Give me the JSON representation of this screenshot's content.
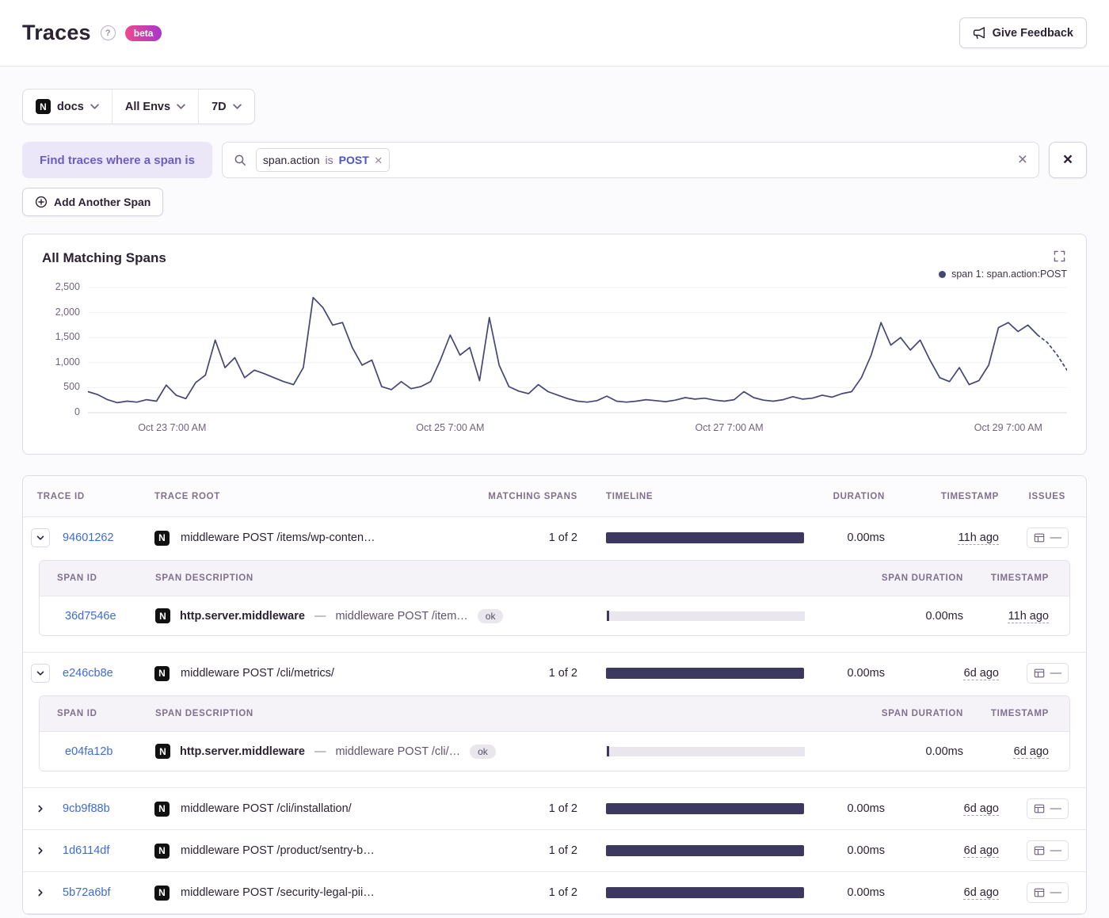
{
  "header": {
    "title": "Traces",
    "beta_label": "beta",
    "feedback_label": "Give Feedback"
  },
  "brand": {
    "project_icon_letter": "N"
  },
  "filters": {
    "project_label": "docs",
    "env_label": "All Envs",
    "period_label": "7D"
  },
  "span_filter": {
    "pill_label": "Find traces where a span is",
    "token_key": "span.action",
    "token_op": "is",
    "token_value": "POST",
    "add_label": "Add Another Span"
  },
  "chart_card": {
    "title": "All Matching Spans",
    "legend_label": "span 1: span.action:POST"
  },
  "chart_data": {
    "type": "line",
    "title": "All Matching Spans",
    "series": [
      {
        "name": "span 1: span.action:POST",
        "values": [
          420,
          360,
          260,
          200,
          230,
          210,
          260,
          230,
          550,
          350,
          280,
          600,
          750,
          1450,
          900,
          1100,
          700,
          850,
          780,
          700,
          620,
          560,
          900,
          2300,
          2100,
          1750,
          1800,
          1300,
          950,
          1050,
          520,
          460,
          620,
          480,
          520,
          620,
          1050,
          1550,
          1150,
          1300,
          640,
          1900,
          950,
          520,
          430,
          380,
          560,
          420,
          350,
          280,
          230,
          210,
          240,
          330,
          230,
          210,
          230,
          260,
          240,
          220,
          250,
          300,
          270,
          290,
          250,
          230,
          260,
          420,
          300,
          250,
          230,
          260,
          320,
          270,
          290,
          350,
          310,
          380,
          420,
          700,
          1150,
          1800,
          1350,
          1500,
          1250,
          1450,
          1050,
          700,
          620,
          900,
          560,
          640,
          950,
          1700,
          1800,
          1620,
          1750,
          1550,
          1400,
          1150,
          850
        ]
      }
    ],
    "ylim": [
      0,
      2500
    ],
    "y_tick_values": [
      0,
      500,
      1000,
      1500,
      2000,
      2500
    ],
    "y_ticks": [
      "0",
      "500",
      "1,000",
      "1,500",
      "2,000",
      "2,500"
    ],
    "x_tick_labels": [
      "Oct 23 7:00 AM",
      "Oct 25 7:00 AM",
      "Oct 27 7:00 AM",
      "Oct 29 7:00 AM"
    ],
    "x_tick_positions": [
      0.086,
      0.37,
      0.655,
      0.94
    ],
    "grid": "horizontal",
    "legend_position": "top-right",
    "dashed_tail_points": 4
  },
  "table": {
    "headers": {
      "trace_id": "TRACE ID",
      "trace_root": "TRACE ROOT",
      "matching": "MATCHING SPANS",
      "timeline": "TIMELINE",
      "duration": "DURATION",
      "timestamp": "TIMESTAMP",
      "issues": "ISSUES"
    },
    "span_headers": {
      "span_id": "SPAN ID",
      "span_description": "SPAN DESCRIPTION",
      "span_duration": "SPAN DURATION",
      "timestamp": "TIMESTAMP"
    },
    "rows": [
      {
        "trace_id": "94601262",
        "root": "middleware POST /items/wp-conten…",
        "matching": "1 of 2",
        "duration": "0.00ms",
        "timestamp": "11h ago",
        "issues": "—",
        "expanded": true,
        "spans": [
          {
            "span_id": "36d7546e",
            "op": "http.server.middleware",
            "separator": "—",
            "description": "middleware POST /item…",
            "status": "ok",
            "duration": "0.00ms",
            "timestamp": "11h ago"
          }
        ]
      },
      {
        "trace_id": "e246cb8e",
        "root": "middleware POST /cli/metrics/",
        "matching": "1 of 2",
        "duration": "0.00ms",
        "timestamp": "6d ago",
        "issues": "—",
        "expanded": true,
        "spans": [
          {
            "span_id": "e04fa12b",
            "op": "http.server.middleware",
            "separator": "—",
            "description": "middleware POST /cli/…",
            "status": "ok",
            "duration": "0.00ms",
            "timestamp": "6d ago"
          }
        ]
      },
      {
        "trace_id": "9cb9f88b",
        "root": "middleware POST /cli/installation/",
        "matching": "1 of 2",
        "duration": "0.00ms",
        "timestamp": "6d ago",
        "issues": "—",
        "expanded": false
      },
      {
        "trace_id": "1d6114df",
        "root": "middleware POST /product/sentry-b…",
        "matching": "1 of 2",
        "duration": "0.00ms",
        "timestamp": "6d ago",
        "issues": "—",
        "expanded": false
      },
      {
        "trace_id": "5b72a6bf",
        "root": "middleware POST /security-legal-pii…",
        "matching": "1 of 2",
        "duration": "0.00ms",
        "timestamp": "6d ago",
        "issues": "—",
        "expanded": false
      }
    ]
  },
  "colors": {
    "accent_purple": "#6a5ec6",
    "link_blue": "#3e6ad8",
    "timeline_bar": "#3d3860",
    "chart_line": "#444674",
    "beta_gradient_start": "#ed4a8f",
    "beta_gradient_end": "#a737c9",
    "status_ok_bg": "#e9e6ed"
  }
}
